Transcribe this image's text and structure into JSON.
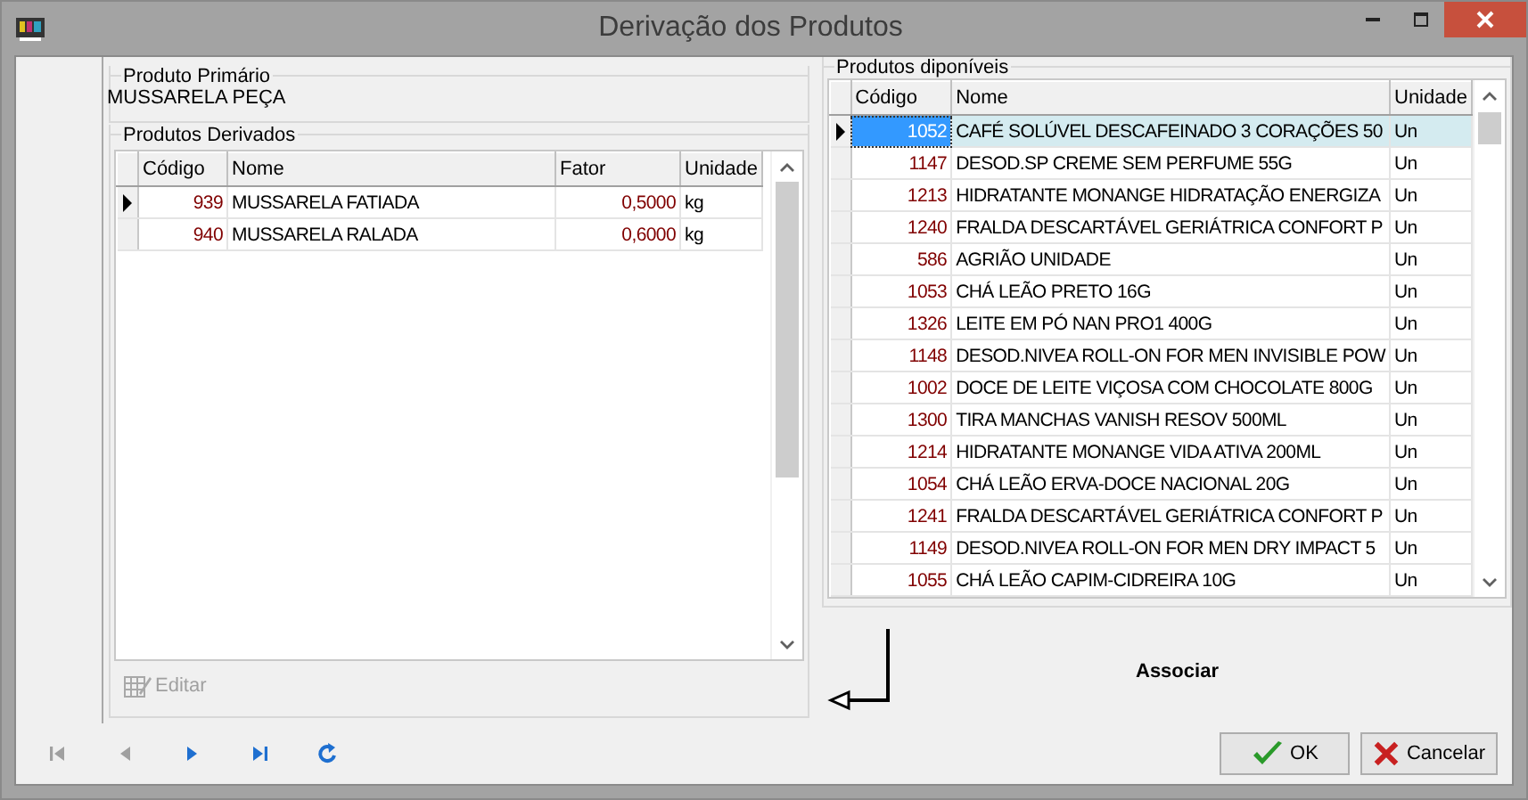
{
  "window": {
    "title": "Derivação dos Produtos"
  },
  "produto_primario": {
    "label": "Produto Primário",
    "value": "MUSSARELA PEÇA"
  },
  "produtos_derivados": {
    "label": "Produtos Derivados",
    "columns": [
      "Código",
      "Nome",
      "Fator",
      "Unidade"
    ],
    "rows": [
      {
        "cells": [
          "939",
          "MUSSARELA FATIADA",
          "0,5000",
          "kg"
        ],
        "current": true
      },
      {
        "cells": [
          "940",
          "MUSSARELA RALADA",
          "0,6000",
          "kg"
        ],
        "current": false
      }
    ],
    "edit_button": {
      "label": "Editar",
      "disabled": true
    }
  },
  "produtos_disponiveis": {
    "label": "Produtos diponíveis",
    "columns": [
      "Código",
      "Nome",
      "Unidade"
    ],
    "rows": [
      {
        "cells": [
          "1052",
          "CAFÉ SOLÚVEL DESCAFEINADO 3 CORAÇÕES 50",
          "Un"
        ],
        "selected": true
      },
      {
        "cells": [
          "1147",
          "DESOD.SP CREME SEM PERFUME 55G",
          "Un"
        ],
        "selected": false
      },
      {
        "cells": [
          "1213",
          "HIDRATANTE MONANGE HIDRATAÇÃO ENERGIZA",
          "Un"
        ],
        "selected": false
      },
      {
        "cells": [
          "1240",
          "FRALDA DESCARTÁVEL GERIÁTRICA CONFORT P",
          "Un"
        ],
        "selected": false
      },
      {
        "cells": [
          "586",
          "AGRIÃO UNIDADE",
          "Un"
        ],
        "selected": false
      },
      {
        "cells": [
          "1053",
          "CHÁ LEÃO PRETO 16G",
          "Un"
        ],
        "selected": false
      },
      {
        "cells": [
          "1326",
          "LEITE EM PÓ NAN PRO1 400G",
          "Un"
        ],
        "selected": false
      },
      {
        "cells": [
          "1148",
          "DESOD.NIVEA ROLL-ON FOR MEN INVISIBLE POW",
          "Un"
        ],
        "selected": false
      },
      {
        "cells": [
          "1002",
          "DOCE DE LEITE VIÇOSA COM CHOCOLATE 800G",
          "Un"
        ],
        "selected": false
      },
      {
        "cells": [
          "1300",
          "TIRA MANCHAS VANISH RESOV 500ML",
          "Un"
        ],
        "selected": false
      },
      {
        "cells": [
          "1214",
          "HIDRATANTE MONANGE VIDA ATIVA 200ML",
          "Un"
        ],
        "selected": false
      },
      {
        "cells": [
          "1054",
          "CHÁ LEÃO ERVA-DOCE NACIONAL 20G",
          "Un"
        ],
        "selected": false
      },
      {
        "cells": [
          "1241",
          "FRALDA DESCARTÁVEL GERIÁTRICA CONFORT P",
          "Un"
        ],
        "selected": false
      },
      {
        "cells": [
          "1149",
          "DESOD.NIVEA ROLL-ON FOR MEN DRY IMPACT 5",
          "Un"
        ],
        "selected": false
      },
      {
        "cells": [
          "1055",
          "CHÁ LEÃO CAPIM-CIDREIRA 10G",
          "Un"
        ],
        "selected": false
      }
    ]
  },
  "associar_button": {
    "label": "Associar"
  },
  "navigator": [
    {
      "kind": "first",
      "disabled": true
    },
    {
      "kind": "prior",
      "disabled": true
    },
    {
      "kind": "next",
      "disabled": false
    },
    {
      "kind": "last",
      "disabled": false
    },
    {
      "kind": "refresh",
      "disabled": false
    }
  ],
  "buttons": [
    {
      "kind": "ok",
      "label": "OK"
    },
    {
      "kind": "cancel",
      "label": "Cancelar"
    }
  ]
}
